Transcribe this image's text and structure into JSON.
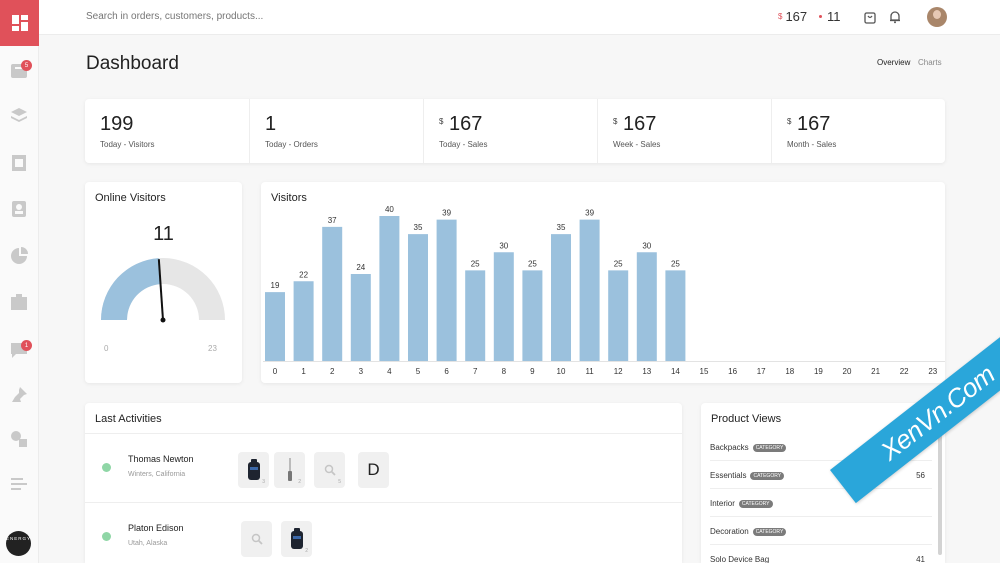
{
  "app": {
    "brand_color": "#e0515a",
    "chart_color": "#9bc1dd"
  },
  "sidebar": {
    "badges": {
      "orders": "5",
      "messages": "1"
    },
    "icons": [
      "orders-icon",
      "layers-icon",
      "catalog-icon",
      "contacts-icon",
      "reports-icon",
      "promotions-icon",
      "messages-icon",
      "pin-icon",
      "extensions-icon",
      "menu-icon"
    ],
    "brand_initials": "ENERGY"
  },
  "topbar": {
    "search_placeholder": "Search in orders, customers, products...",
    "currency": "$",
    "sales_total": "167",
    "orders_total": "11"
  },
  "header": {
    "title": "Dashboard",
    "tabs": [
      "Overview",
      "Charts"
    ]
  },
  "stats": [
    {
      "value": "199",
      "label": "Today - Visitors",
      "currency": ""
    },
    {
      "value": "1",
      "label": "Today - Orders",
      "currency": ""
    },
    {
      "value": "167",
      "label": "Today - Sales",
      "currency": "$"
    },
    {
      "value": "167",
      "label": "Week - Sales",
      "currency": "$"
    },
    {
      "value": "167",
      "label": "Month - Sales",
      "currency": "$"
    }
  ],
  "online": {
    "title": "Online Visitors",
    "value": "11",
    "min": "0",
    "max": "23",
    "fraction": 0.4783
  },
  "chart_data": {
    "type": "bar",
    "title": "Visitors",
    "categories": [
      "0",
      "1",
      "2",
      "3",
      "4",
      "5",
      "6",
      "7",
      "8",
      "9",
      "10",
      "11",
      "12",
      "13",
      "14",
      "15",
      "16",
      "17",
      "18",
      "19",
      "20",
      "21",
      "22",
      "23"
    ],
    "values": [
      19,
      22,
      37,
      24,
      40,
      35,
      39,
      25,
      30,
      25,
      35,
      39,
      25,
      30,
      25,
      null,
      null,
      null,
      null,
      null,
      null,
      null,
      null,
      null
    ],
    "ylim": [
      0,
      40
    ],
    "grid": false
  },
  "activities": {
    "title": "Last Activities",
    "items": [
      {
        "name": "Thomas Newton",
        "location": "Winters, California",
        "thumbs": [
          {
            "kind": "bag",
            "count": "3"
          },
          {
            "kind": "tool",
            "count": "2"
          },
          {
            "kind": "search",
            "count": "5"
          },
          {
            "kind": "letter",
            "text": "D",
            "count": ""
          }
        ]
      },
      {
        "name": "Platon Edison",
        "location": "Utah, Alaska",
        "thumbs": [
          {
            "kind": "search",
            "count": ""
          },
          {
            "kind": "bag",
            "count": "2"
          }
        ]
      }
    ]
  },
  "product_views": {
    "title": "Product Views",
    "category_badge": "CATEGORY",
    "items": [
      {
        "name": "Backpacks",
        "category": true,
        "count": "95"
      },
      {
        "name": "Essentials",
        "category": true,
        "count": "56"
      },
      {
        "name": "Interior",
        "category": true,
        "count": ""
      },
      {
        "name": "Decoration",
        "category": true,
        "count": ""
      },
      {
        "name": "Solo Device Bag",
        "category": false,
        "count": "41"
      }
    ]
  },
  "watermark": {
    "text": "XenVn.Com"
  }
}
